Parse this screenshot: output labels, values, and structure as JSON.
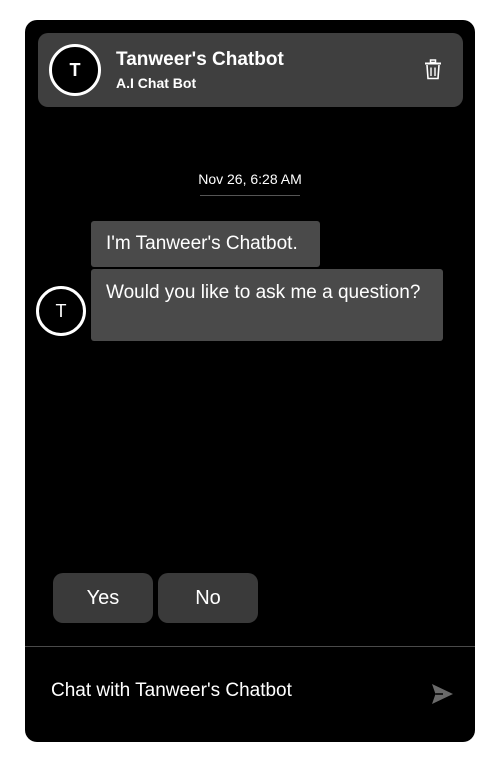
{
  "header": {
    "avatar_letter": "T",
    "title": "Tanweer's Chatbot",
    "subtitle": "A.I Chat Bot",
    "delete_icon": "trash-icon"
  },
  "conversation": {
    "timestamp": "Nov 26, 6:28 AM",
    "bot_avatar_letter": "T",
    "messages": [
      {
        "sender": "bot",
        "text": "I'm Tanweer's Chatbot."
      },
      {
        "sender": "bot",
        "text": "Would you like to ask me a question?"
      }
    ]
  },
  "quick_replies": [
    {
      "label": "Yes"
    },
    {
      "label": "No"
    }
  ],
  "composer": {
    "placeholder": "Chat with Tanweer's Chatbot",
    "value": "",
    "send_icon": "send-icon"
  },
  "colors": {
    "background": "#000000",
    "header_bg": "#3f3f3f",
    "bubble_bg": "#4a4a4a",
    "button_bg": "#3a3a3a",
    "text": "#ffffff",
    "send_icon": "#6a6a6a"
  }
}
